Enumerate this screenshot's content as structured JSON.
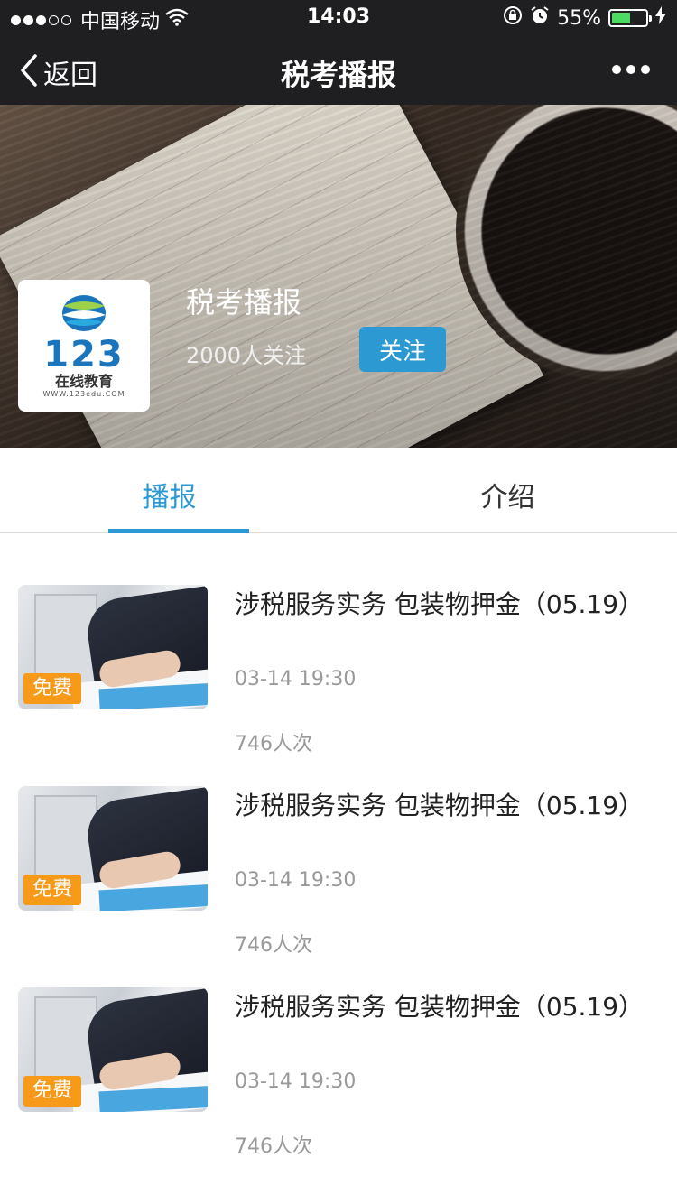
{
  "status_bar": {
    "carrier": "中国移动",
    "time": "14:03",
    "battery_percent": "55%",
    "battery_level": 0.55,
    "signal_bars_filled": 3
  },
  "nav": {
    "back_label": "返回",
    "title": "税考播报"
  },
  "hero": {
    "name": "税考播报",
    "followers": "2000人关注",
    "follow_button": "关注",
    "logo": {
      "number": "123",
      "text": "在线教育",
      "url": "WWW.123edu.COM"
    }
  },
  "tabs": [
    {
      "label": "播报",
      "active": true
    },
    {
      "label": "介绍",
      "active": false
    }
  ],
  "items": [
    {
      "title": "涉税服务实务 包装物押金（05.19）",
      "time": "03-14 19:30",
      "views": "746人次",
      "badge": "免费"
    },
    {
      "title": "涉税服务实务 包装物押金（05.19）",
      "time": "03-14 19:30",
      "views": "746人次",
      "badge": "免费"
    },
    {
      "title": "涉税服务实务 包装物押金（05.19）",
      "time": "03-14 19:30",
      "views": "746人次",
      "badge": "免费"
    }
  ],
  "colors": {
    "accent": "#2c99d3",
    "badge": "#f79a1a",
    "topbar": "#1f1f21",
    "battery_fill": "#4cd964"
  }
}
